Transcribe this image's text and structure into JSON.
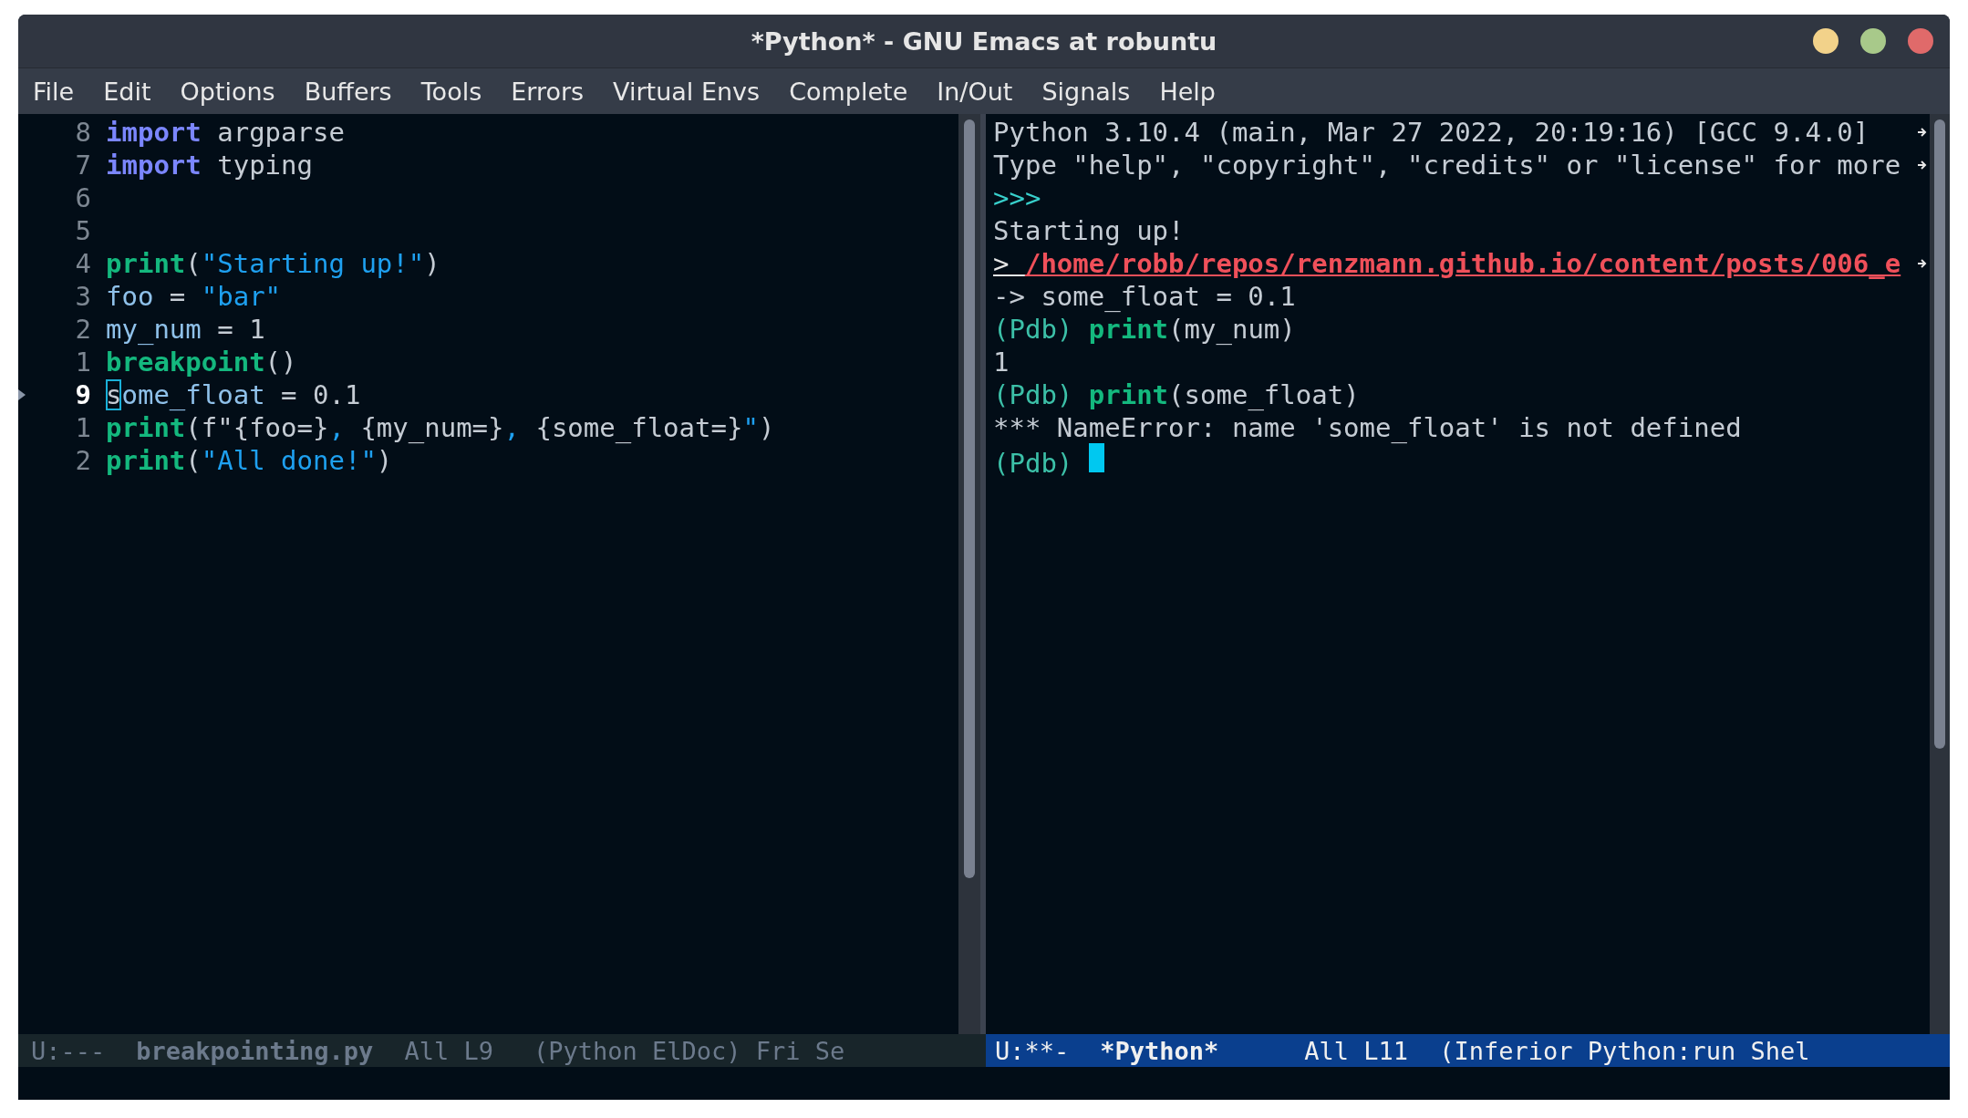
{
  "window": {
    "title": "*Python* - GNU Emacs at robuntu"
  },
  "menu": [
    "File",
    "Edit",
    "Options",
    "Buffers",
    "Tools",
    "Errors",
    "Virtual Envs",
    "Complete",
    "In/Out",
    "Signals",
    "Help"
  ],
  "editor": {
    "lines": [
      {
        "number": "8",
        "current": false,
        "tokens": [
          {
            "kind": "keyword",
            "text": "import"
          },
          {
            "kind": "plain",
            "text": " argparse"
          }
        ]
      },
      {
        "number": "7",
        "current": false,
        "tokens": [
          {
            "kind": "keyword",
            "text": "import"
          },
          {
            "kind": "plain",
            "text": " typing"
          }
        ]
      },
      {
        "number": "6",
        "current": false
      },
      {
        "number": "5",
        "current": false
      },
      {
        "number": "4",
        "current": false,
        "tokens": [
          {
            "kind": "builtin",
            "text": "print"
          },
          {
            "kind": "plain",
            "text": "("
          },
          {
            "kind": "string",
            "text": "\"Starting up!\""
          },
          {
            "kind": "plain",
            "text": ")"
          }
        ]
      },
      {
        "number": "3",
        "current": false,
        "tokens": [
          {
            "kind": "variable",
            "text": "foo"
          },
          {
            "kind": "plain",
            "text": " = "
          },
          {
            "kind": "string",
            "text": "\"bar\""
          }
        ]
      },
      {
        "number": "2",
        "current": false,
        "tokens": [
          {
            "kind": "variable",
            "text": "my_num"
          },
          {
            "kind": "plain",
            "text": " = 1"
          }
        ]
      },
      {
        "number": "1",
        "current": false,
        "tokens": [
          {
            "kind": "builtin",
            "text": "breakpoint"
          },
          {
            "kind": "plain",
            "text": "()"
          }
        ]
      },
      {
        "number": "9",
        "current": true,
        "tokens": [
          {
            "kind": "cursor",
            "text": "s"
          },
          {
            "kind": "variable",
            "text": "ome_float"
          },
          {
            "kind": "plain",
            "text": " = 0.1"
          }
        ]
      },
      {
        "number": "1",
        "current": false,
        "tokens": [
          {
            "kind": "builtin",
            "text": "print"
          },
          {
            "kind": "plain",
            "text": "(f\"{foo=}"
          },
          {
            "kind": "string",
            "text": ", "
          },
          {
            "kind": "plain",
            "text": "{my_num=}"
          },
          {
            "kind": "string",
            "text": ", "
          },
          {
            "kind": "plain",
            "text": "{some_float=}"
          },
          {
            "kind": "string",
            "text": "\""
          },
          {
            "kind": "plain",
            "text": ")"
          }
        ]
      },
      {
        "number": "2",
        "current": false,
        "tokens": [
          {
            "kind": "builtin",
            "text": "print"
          },
          {
            "kind": "plain",
            "text": "("
          },
          {
            "kind": "string",
            "text": "\"All done!\""
          },
          {
            "kind": "plain",
            "text": ")"
          }
        ]
      }
    ]
  },
  "shell": {
    "lines": [
      {
        "continued": true,
        "tokens": [
          {
            "kind": "plain",
            "text": "Python 3.10.4 (main, Mar 27 2022, 20:19:16) [GCC 9.4.0]"
          }
        ]
      },
      {
        "continued": true,
        "tokens": [
          {
            "kind": "plain",
            "text": "Type \"help\", \"copyright\", \"credits\" or \"license\" for more"
          }
        ]
      },
      {
        "continued": false,
        "tokens": [
          {
            "kind": "prompt",
            "text": ">>>"
          }
        ]
      },
      {
        "continued": false,
        "tokens": [
          {
            "kind": "plain",
            "text": "Starting up!"
          }
        ]
      },
      {
        "continued": true,
        "tokens": [
          {
            "kind": "link",
            "text": "> "
          },
          {
            "kind": "path",
            "text": "/home/robb/repos/renzmann.github.io/content/posts/006_e"
          }
        ]
      },
      {
        "continued": false,
        "tokens": [
          {
            "kind": "plain",
            "text": "-> some_float = 0.1"
          }
        ]
      },
      {
        "continued": false,
        "tokens": [
          {
            "kind": "pdb",
            "text": "(Pdb) "
          },
          {
            "kind": "builtin",
            "text": "print"
          },
          {
            "kind": "plain",
            "text": "(my_num)"
          }
        ]
      },
      {
        "continued": false,
        "tokens": [
          {
            "kind": "plain",
            "text": "1"
          }
        ]
      },
      {
        "continued": false,
        "tokens": [
          {
            "kind": "pdb",
            "text": "(Pdb) "
          },
          {
            "kind": "builtin",
            "text": "print"
          },
          {
            "kind": "plain",
            "text": "(some_float)"
          }
        ]
      },
      {
        "continued": false,
        "tokens": [
          {
            "kind": "plain",
            "text": "*** NameError: name 'some_float' is not defined"
          }
        ]
      },
      {
        "continued": false,
        "tokens": [
          {
            "kind": "pdb",
            "text": "(Pdb) "
          },
          {
            "kind": "block-cursor"
          }
        ]
      }
    ]
  },
  "mode_lines": [
    {
      "active": false,
      "fields": [
        {
          "kind": "status",
          "text": "U:---"
        },
        {
          "kind": "buffer",
          "text": "breakpointing.py"
        },
        {
          "kind": "position",
          "text": "All L9"
        },
        {
          "kind": "modes",
          "text": "(Python ElDoc) Fri Se"
        }
      ]
    },
    {
      "active": true,
      "fields": [
        {
          "kind": "status",
          "text": "U:**-"
        },
        {
          "kind": "buffer",
          "text": "*Python*"
        },
        {
          "kind": "position",
          "text": "All L11"
        },
        {
          "kind": "modes",
          "text": "(Inferior Python:run Shel"
        }
      ]
    }
  ]
}
